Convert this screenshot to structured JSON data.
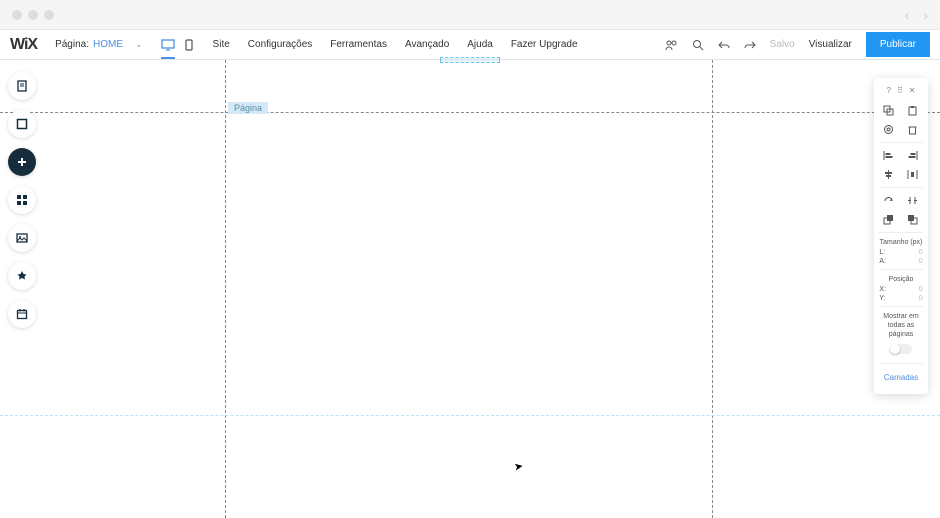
{
  "browser": {
    "back": "‹",
    "forward": "›"
  },
  "logo": "WiX",
  "pageSelector": {
    "label": "Página:",
    "current": "HOME"
  },
  "menu": {
    "site": "Site",
    "config": "Configurações",
    "ferramentas": "Ferramentas",
    "avancado": "Avançado",
    "ajuda": "Ajuda",
    "upgrade": "Fazer Upgrade"
  },
  "actions": {
    "salvo": "Salvo",
    "visualizar": "Visualizar",
    "publicar": "Publicar"
  },
  "canvas": {
    "pageLabel": "Página"
  },
  "rightPanel": {
    "sizeTitle": "Tamanho (px)",
    "L": "L:",
    "Lval": "0",
    "A": "A:",
    "Aval": "0",
    "posTitle": "Posição",
    "X": "X:",
    "Xval": "0",
    "Y": "Y:",
    "Yval": "0",
    "showAll": "Mostrar em todas as páginas",
    "layers": "Camadas"
  }
}
